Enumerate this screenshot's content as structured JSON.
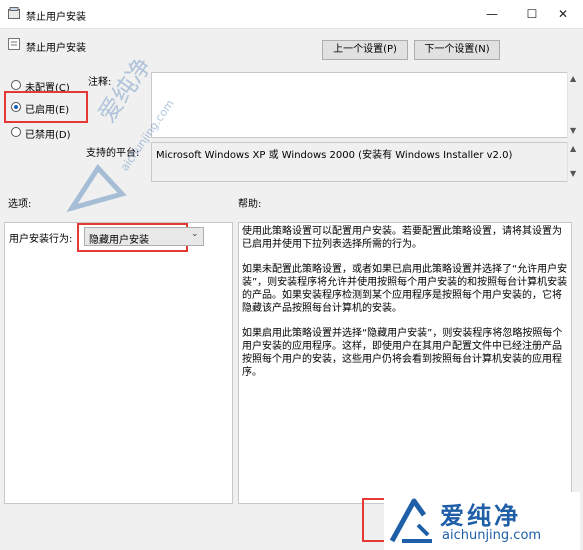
{
  "window": {
    "title": "禁止用户安装",
    "minimize_glyph": "—",
    "maximize_glyph": "☐",
    "close_glyph": "✕"
  },
  "header": {
    "policy_name": "禁止用户安装",
    "prev_button": "上一个设置(P)",
    "next_button": "下一个设置(N)"
  },
  "state": {
    "not_configured": "未配置(C)",
    "enabled": "已启用(E)",
    "disabled": "已禁用(D)",
    "selected": "enabled"
  },
  "comment": {
    "label": "注释:",
    "value": ""
  },
  "platform": {
    "label": "支持的平台:",
    "value": "Microsoft Windows XP 或 Windows 2000 (安装有 Windows Installer v2.0)"
  },
  "options": {
    "section_label": "选项:",
    "behavior_label": "用户安装行为:",
    "behavior_value": "隐藏用户安装"
  },
  "help": {
    "section_label": "帮助:",
    "paragraphs": [
      "使用此策略设置可以配置用户安装。若要配置此策略设置，请将其设置为已启用并使用下拉列表选择所需的行为。",
      "如果未配置此策略设置，或者如果已启用此策略设置并选择了“允许用户安装”，则安装程序将允许并使用按照每个用户安装的和按照每台计算机安装的产品。如果安装程序检测到某个应用程序是按照每个用户安装的，它将隐藏该产品按照每台计算机的安装。",
      "如果启用此策略设置并选择“隐藏用户安装”，则安装程序将忽略按照每个用户安装的应用程序。这样，即使用户在其用户配置文件中已经注册产品按照每个用户的安装，这些用户仍将会看到按照每台计算机安装的应用程序。"
    ]
  },
  "watermark": {
    "diagonal_cn": "爱纯净",
    "diagonal_url": "aichunjing.com",
    "logo_cn": "爱纯净",
    "logo_url": "aichunjing.com"
  },
  "colors": {
    "highlight_red": "#e53935",
    "radio_blue": "#1a5fb4",
    "watermark_blue": "#1f5fa8"
  }
}
